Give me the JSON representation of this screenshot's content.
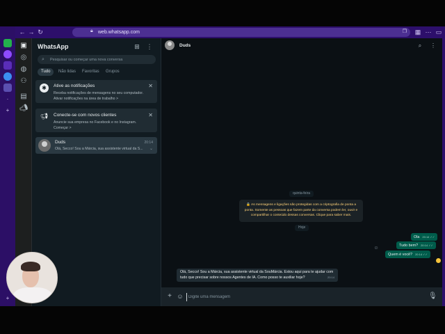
{
  "browser": {
    "url": "web.whatsapp.com"
  },
  "sidebar": {
    "title": "WhatsApp",
    "search_placeholder": "Pesquisar ou começar uma nova conversa",
    "filters": [
      "Tudo",
      "Não lidas",
      "Favoritas",
      "Grupos"
    ],
    "active_filter": "Tudo",
    "notifications_card": {
      "title": "Ative as notificações",
      "line1": "Receba notificações de mensagens no seu computador.",
      "line2": "Ativar notificações na área de trabalho",
      "chevron": ">"
    },
    "clients_card": {
      "title": "Conecte-se com novos clientes",
      "line1": "Anuncie sua empresa no Facebook e no Instagram.",
      "line2": "Começar",
      "chevron": ">"
    },
    "chat": {
      "name": "Duds",
      "time": "20:14",
      "preview": "Olá, Secco! Sou a Márcia, sua assistente virtual da S..."
    }
  },
  "conversation": {
    "name": "Duds",
    "day1": "quinta-feira",
    "encryption": "🔒 As mensagens e ligações são protegidas com a criptografia de ponta a ponta. Somente as pessoas que fazem parte da conversa podem ler, ouvir e compartilhar o conteúdo dessas conversas. Clique para saber mais.",
    "day2": "Hoje",
    "outgoing": [
      {
        "text": "Ola",
        "time": "20:14 ✓✓"
      },
      {
        "text": "Tudo bem?",
        "time": "20:14 ✓✓"
      },
      {
        "text": "Quem é você?",
        "time": "20:14 ✓✓"
      }
    ],
    "incoming": {
      "line1": "Olá, Secco! Sou a Márcia, sua assistente virtual da SouMárcia. Estou aqui para te ajudar com",
      "line2": "tudo que precisar sobre nossos Agentes de IA. Como posso te auxiliar hoje?",
      "time": "20:14"
    },
    "input_placeholder": "Digite uma mensagem"
  },
  "colors": {
    "accent": "#00a884",
    "outgoing_bubble": "#005c4b",
    "incoming_bubble": "#202c33",
    "browser_frame": "#2d0f6b"
  }
}
